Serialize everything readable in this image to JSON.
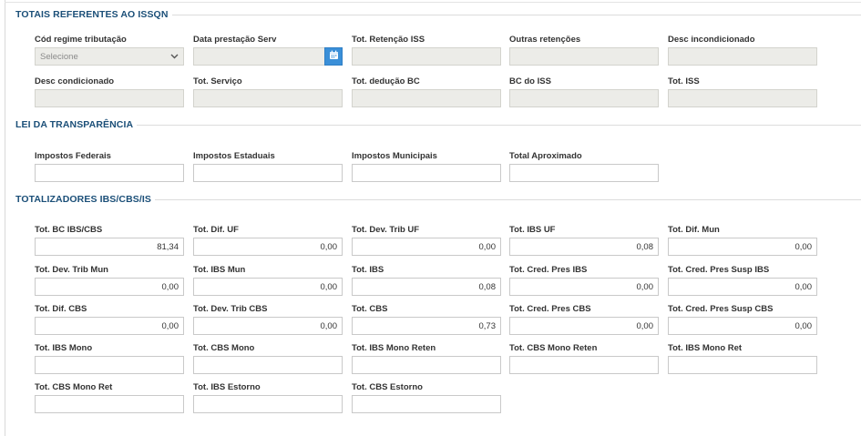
{
  "sections": {
    "issqn": {
      "title": "TOTAIS REFERENTES AO ISSQN",
      "fields": [
        {
          "label": "Cód regime tributação",
          "kind": "select",
          "value": "Selecione"
        },
        {
          "label": "Data prestação Serv",
          "kind": "date",
          "value": ""
        },
        {
          "label": "Tot. Retenção ISS",
          "value": ""
        },
        {
          "label": "Outras retenções",
          "value": ""
        },
        {
          "label": "Desc incondicionado",
          "value": ""
        },
        {
          "label": "Desc condicionado",
          "value": ""
        },
        {
          "label": "Tot. Serviço",
          "value": ""
        },
        {
          "label": "Tot. dedução BC",
          "value": ""
        },
        {
          "label": "BC do ISS",
          "value": ""
        },
        {
          "label": "Tot. ISS",
          "value": ""
        }
      ]
    },
    "transparencia": {
      "title": "LEI DA TRANSPARÊNCIA",
      "fields": [
        {
          "label": "Impostos Federais",
          "value": ""
        },
        {
          "label": "Impostos Estaduais",
          "value": ""
        },
        {
          "label": "Impostos Municipais",
          "value": ""
        },
        {
          "label": "Total Aproximado",
          "value": ""
        }
      ]
    },
    "ibs_cbs": {
      "title": "TOTALIZADORES IBS/CBS/IS",
      "fields": [
        {
          "label": "Tot. BC IBS/CBS",
          "value": "81,34"
        },
        {
          "label": "Tot. Dif. UF",
          "value": "0,00"
        },
        {
          "label": "Tot. Dev. Trib UF",
          "value": "0,00"
        },
        {
          "label": "Tot. IBS UF",
          "value": "0,08"
        },
        {
          "label": "Tot. Dif. Mun",
          "value": "0,00"
        },
        {
          "label": "Tot. Dev. Trib Mun",
          "value": "0,00"
        },
        {
          "label": "Tot. IBS Mun",
          "value": "0,00"
        },
        {
          "label": "Tot. IBS",
          "value": "0,08"
        },
        {
          "label": "Tot. Cred. Pres IBS",
          "value": "0,00"
        },
        {
          "label": "Tot. Cred. Pres Susp IBS",
          "value": "0,00"
        },
        {
          "label": "Tot. Dif. CBS",
          "value": "0,00"
        },
        {
          "label": "Tot. Dev. Trib CBS",
          "value": "0,00"
        },
        {
          "label": "Tot. CBS",
          "value": "0,73"
        },
        {
          "label": "Tot. Cred. Pres CBS",
          "value": "0,00"
        },
        {
          "label": "Tot. Cred. Pres Susp CBS",
          "value": "0,00"
        },
        {
          "label": "Tot. IBS Mono",
          "value": ""
        },
        {
          "label": "Tot. CBS Mono",
          "value": ""
        },
        {
          "label": "Tot. IBS Mono Reten",
          "value": ""
        },
        {
          "label": "Tot. CBS Mono Reten",
          "value": ""
        },
        {
          "label": "Tot. IBS Mono Ret",
          "value": ""
        },
        {
          "label": "Tot. CBS Mono Ret",
          "value": ""
        },
        {
          "label": "Tot. IBS Estorno",
          "value": ""
        },
        {
          "label": "Tot. CBS Estorno",
          "value": ""
        }
      ]
    }
  },
  "icons": {
    "calendar": "calendar-icon",
    "chevron": "chevron-down-icon"
  },
  "colors": {
    "section_title": "#1b4f78",
    "calendar_button": "#3a8fd8",
    "disabled_field": "#ecece8"
  }
}
